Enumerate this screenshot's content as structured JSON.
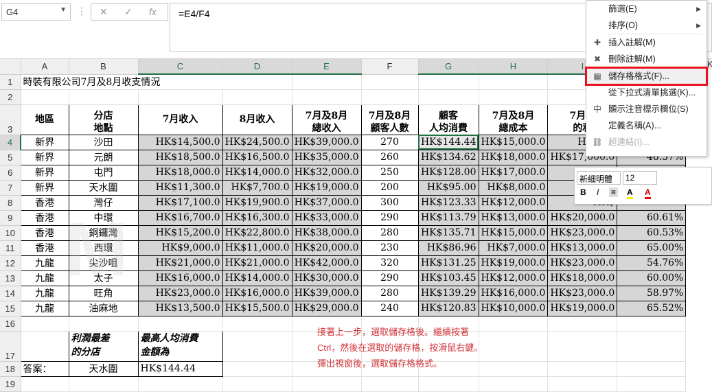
{
  "formula_bar": {
    "name_box": "G4",
    "cancel_icon": "✕",
    "enter_icon": "✓",
    "fx_icon": "fx",
    "formula": "=E4/F4"
  },
  "columns": [
    "A",
    "B",
    "C",
    "D",
    "E",
    "F",
    "G",
    "H",
    "I",
    "J",
    "K"
  ],
  "rows": {
    "r1": "時裝有限公司7月及8月收支情況",
    "headers": {
      "a": "地區",
      "b1": "分店",
      "b2": "地點",
      "c": "7月收入",
      "d": "8月收入",
      "e1": "7月及8月",
      "e2": "總收入",
      "f1": "7月及8月",
      "f2": "顧客人數",
      "g1": "顧客",
      "g2": "人均消費",
      "h1": "7月及8月",
      "h2": "總成本",
      "i1": "7月及",
      "i2": "的利"
    },
    "data": [
      {
        "r": "4",
        "a": "新界",
        "b": "沙田",
        "c": "HK$14,500.0",
        "d": "HK$24,500.0",
        "e": "HK$39,000.0",
        "f": "270",
        "g": "HK$144.44",
        "h": "HK$15,000.0",
        "i": "HK$24,",
        "j": ""
      },
      {
        "r": "5",
        "a": "新界",
        "b": "元朗",
        "c": "HK$18,500.0",
        "d": "HK$16,500.0",
        "e": "HK$35,000.0",
        "f": "260",
        "g": "HK$134.62",
        "h": "HK$18,000.0",
        "i": "HK$17,000.0",
        "j": "48.57%"
      },
      {
        "r": "6",
        "a": "新界",
        "b": "屯門",
        "c": "HK$18,000.0",
        "d": "HK$14,000.0",
        "e": "HK$32,000.0",
        "f": "250",
        "g": "HK$128.00",
        "h": "HK$17,000.0",
        "i": "HK$",
        "j": ""
      },
      {
        "r": "7",
        "a": "新界",
        "b": "天水圍",
        "c": "HK$11,300.0",
        "d": "HK$7,700.0",
        "e": "HK$19,000.0",
        "f": "200",
        "g": "HK$95.00",
        "h": "HK$8,000.0",
        "i": "HK$",
        "j": ""
      },
      {
        "r": "8",
        "a": "香港",
        "b": "灣仔",
        "c": "HK$17,100.0",
        "d": "HK$19,900.0",
        "e": "HK$37,000.0",
        "f": "300",
        "g": "HK$123.33",
        "h": "HK$12,000.0",
        "i": "HK$",
        "j": ""
      },
      {
        "r": "9",
        "a": "香港",
        "b": "中環",
        "c": "HK$16,700.0",
        "d": "HK$16,300.0",
        "e": "HK$33,000.0",
        "f": "290",
        "g": "HK$113.79",
        "h": "HK$13,000.0",
        "i": "HK$20,000.0",
        "j": "60.61%"
      },
      {
        "r": "10",
        "a": "香港",
        "b": "銅鑼灣",
        "c": "HK$15,200.0",
        "d": "HK$22,800.0",
        "e": "HK$38,000.0",
        "f": "280",
        "g": "HK$135.71",
        "h": "HK$15,000.0",
        "i": "HK$23,000.0",
        "j": "60.53%"
      },
      {
        "r": "11",
        "a": "香港",
        "b": "西環",
        "c": "HK$9,000.0",
        "d": "HK$11,000.0",
        "e": "HK$20,000.0",
        "f": "230",
        "g": "HK$86.96",
        "h": "HK$7,000.0",
        "i": "HK$13,000.0",
        "j": "65.00%"
      },
      {
        "r": "12",
        "a": "九龍",
        "b": "尖沙咀",
        "c": "HK$21,000.0",
        "d": "HK$21,000.0",
        "e": "HK$42,000.0",
        "f": "320",
        "g": "HK$131.25",
        "h": "HK$19,000.0",
        "i": "HK$23,000.0",
        "j": "54.76%"
      },
      {
        "r": "13",
        "a": "九龍",
        "b": "太子",
        "c": "HK$16,000.0",
        "d": "HK$14,000.0",
        "e": "HK$30,000.0",
        "f": "290",
        "g": "HK$103.45",
        "h": "HK$12,000.0",
        "i": "HK$18,000.0",
        "j": "60.00%"
      },
      {
        "r": "14",
        "a": "九龍",
        "b": "旺角",
        "c": "HK$23,000.0",
        "d": "HK$16,000.0",
        "e": "HK$39,000.0",
        "f": "280",
        "g": "HK$139.29",
        "h": "HK$16,000.0",
        "i": "HK$23,000.0",
        "j": "58.97%"
      },
      {
        "r": "15",
        "a": "九龍",
        "b": "油麻地",
        "c": "HK$13,500.0",
        "d": "HK$15,500.0",
        "e": "HK$29,000.0",
        "f": "240",
        "g": "HK$120.83",
        "h": "HK$10,000.0",
        "i": "HK$19,000.0",
        "j": "65.52%"
      }
    ],
    "r17_b1": "利潤最差",
    "r17_b2": "的分店",
    "r17_c1": "最高人均消費",
    "r17_c2": "金額為",
    "r18_a": "答案：",
    "r18_b": "天水圍",
    "r18_c": "HK$144.44"
  },
  "row_numbers": [
    "1",
    "2",
    "3",
    "4",
    "5",
    "6",
    "7",
    "8",
    "9",
    "10",
    "11",
    "12",
    "13",
    "14",
    "15",
    "16",
    "17",
    "18",
    "19"
  ],
  "note_lines": [
    "接著上一步，選取儲存格後。繼續按著",
    "Ctrl，然後在選取的儲存格，按滑鼠右鍵。",
    "彈出視窗後，選取儲存格格式。"
  ],
  "context_menu": {
    "items": [
      {
        "label": "篩選(E)",
        "icon": "",
        "arrow": "▶"
      },
      {
        "label": "排序(O)",
        "icon": "",
        "arrow": "▶"
      },
      {
        "label": "插入註解(M)",
        "icon": "✚",
        "arrow": ""
      },
      {
        "label": "刪除註解(M)",
        "icon": "✖",
        "arrow": ""
      },
      {
        "label": "儲存格格式(F)...",
        "icon": "▦",
        "arrow": ""
      },
      {
        "label": "從下拉式清單挑選(K)...",
        "icon": "",
        "arrow": ""
      },
      {
        "label": "顯示注音標示欄位(S)",
        "icon": "中",
        "arrow": ""
      },
      {
        "label": "定義名稱(A)...",
        "icon": "",
        "arrow": ""
      },
      {
        "label": "超連結(I)...",
        "icon": "⛓",
        "arrow": ""
      }
    ]
  },
  "mini_toolbar": {
    "font": "新細明體",
    "size": "12",
    "bold": "B",
    "italic": "I",
    "align": "≡",
    "fill": "A",
    "font_color": "A"
  },
  "watermark": "M",
  "colors": {
    "accent": "#217346",
    "highlight_border": "#e8111d",
    "note": "#d13438",
    "shade": "#d6d6d6"
  }
}
